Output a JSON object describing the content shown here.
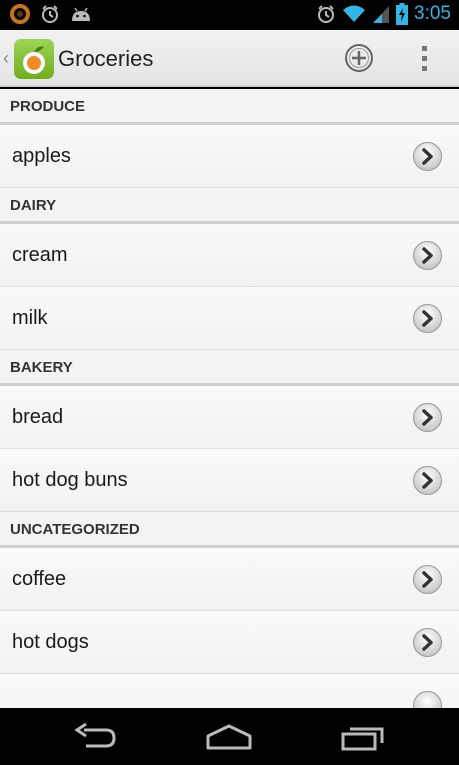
{
  "status_bar": {
    "time": "3:05",
    "left_icons": [
      "circle-app-icon",
      "alarm-icon",
      "android-icon"
    ],
    "right_icons": [
      "alarm-icon",
      "wifi-icon",
      "signal-icon",
      "battery-icon"
    ],
    "accent_color": "#33b5e5"
  },
  "action_bar": {
    "title": "Groceries",
    "actions": [
      "add-icon",
      "overflow-menu-icon"
    ]
  },
  "sections": [
    {
      "header": "PRODUCE",
      "items": [
        "apples"
      ]
    },
    {
      "header": "DAIRY",
      "items": [
        "cream",
        "milk"
      ]
    },
    {
      "header": "BAKERY",
      "items": [
        "bread",
        "hot dog buns"
      ]
    },
    {
      "header": "UNCATEGORIZED",
      "items": [
        "coffee",
        "hot dogs"
      ]
    }
  ],
  "nav_bar": {
    "buttons": [
      "back-icon",
      "home-icon",
      "recents-icon"
    ]
  }
}
